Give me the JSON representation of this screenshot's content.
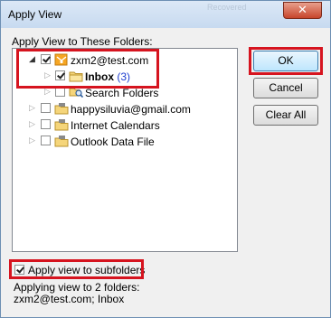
{
  "window": {
    "title": "Apply View",
    "ghost_text": "Recovered",
    "close_symbol": "✕"
  },
  "section_label": "Apply View to These Folders:",
  "tree": [
    {
      "label": "zxm2@test.com",
      "checked": true,
      "icon": "account-icon",
      "expander": "expanded"
    },
    {
      "label": "Inbox",
      "count": "(3)",
      "checked": true,
      "icon": "folder-icon",
      "expander": "collapsed"
    },
    {
      "label": "Search Folders",
      "checked": false,
      "icon": "search-folder-icon",
      "expander": "collapsed"
    },
    {
      "label": "happysiluvia@gmail.com",
      "checked": false,
      "icon": "data-file-icon",
      "expander": "collapsed"
    },
    {
      "label": "Internet Calendars",
      "checked": false,
      "icon": "data-file-icon",
      "expander": "collapsed"
    },
    {
      "label": "Outlook Data File",
      "checked": false,
      "icon": "data-file-icon",
      "expander": "collapsed"
    }
  ],
  "buttons": {
    "ok": "OK",
    "cancel": "Cancel",
    "clear_all": "Clear All"
  },
  "apply_subfolders": {
    "label": "Apply view to subfolders",
    "checked": true
  },
  "status": {
    "line1": "Applying view to 2 folders:",
    "line2": "zxm2@test.com; Inbox"
  },
  "colors": {
    "highlight": "#d6141f",
    "count": "#1c3ccf",
    "title_bar": "#c7daf0"
  }
}
